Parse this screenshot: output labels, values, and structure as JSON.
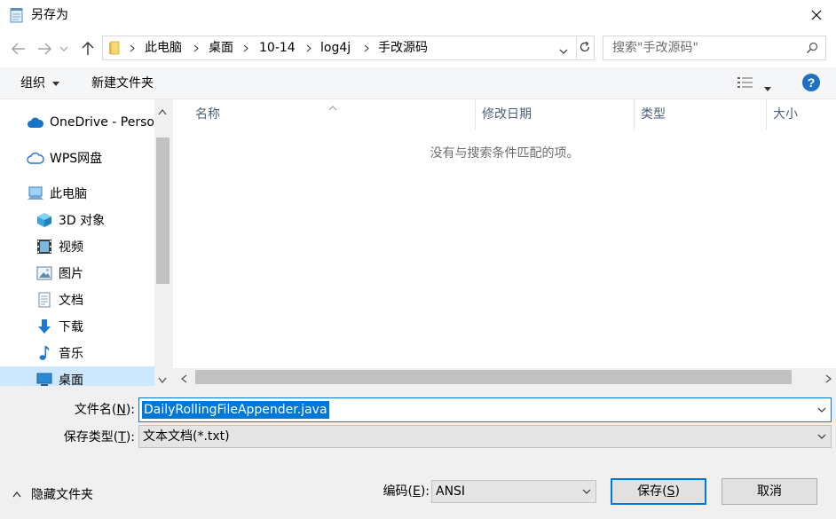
{
  "window": {
    "title": "另存为",
    "close_icon": "close-icon"
  },
  "nav": {
    "back_icon": "arrow-left-icon",
    "forward_icon": "arrow-right-icon",
    "recent_icon": "chevron-down-icon",
    "up_icon": "arrow-up-icon",
    "breadcrumb": [
      "此电脑",
      "桌面",
      "10-14",
      "log4j",
      "手改源码"
    ],
    "search_placeholder": "搜索\"手改源码\""
  },
  "toolbar": {
    "organize_label": "组织",
    "new_folder_label": "新建文件夹"
  },
  "navpane": {
    "items": [
      {
        "label": "OneDrive - Personal",
        "icon": "cloud-icon"
      },
      {
        "label": "WPS网盘",
        "icon": "cloud-outline-icon"
      },
      {
        "label": "此电脑",
        "icon": "computer-icon"
      },
      {
        "label": "3D 对象",
        "icon": "cube-icon"
      },
      {
        "label": "视频",
        "icon": "film-icon"
      },
      {
        "label": "图片",
        "icon": "picture-icon"
      },
      {
        "label": "文档",
        "icon": "document-icon"
      },
      {
        "label": "下载",
        "icon": "download-arrow-icon"
      },
      {
        "label": "音乐",
        "icon": "music-note-icon"
      },
      {
        "label": "桌面",
        "icon": "desktop-icon"
      }
    ],
    "selected_index": 9
  },
  "filelist": {
    "columns": [
      "名称",
      "修改日期",
      "类型",
      "大小"
    ],
    "empty_message": "没有与搜索条件匹配的项。"
  },
  "form": {
    "filename_label_prefix": "文件名(",
    "filename_label_key": "N",
    "filename_label_suffix": "):",
    "filename_value": "DailyRollingFileAppender.java",
    "filetype_label_prefix": "保存类型(",
    "filetype_label_key": "T",
    "filetype_label_suffix": "):",
    "filetype_value": "文本文档(*.txt)",
    "hide_folders_label": "隐藏文件夹",
    "encoding_label_prefix": "编码(",
    "encoding_label_key": "E",
    "encoding_label_suffix": "):",
    "encoding_value": "ANSI",
    "save_label_prefix": "保存(",
    "save_label_key": "S",
    "save_label_suffix": ")",
    "cancel_label": "取消"
  },
  "colors": {
    "accent": "#0078d7",
    "selected_bg": "#cce8ff",
    "header_text": "#4c607a"
  }
}
